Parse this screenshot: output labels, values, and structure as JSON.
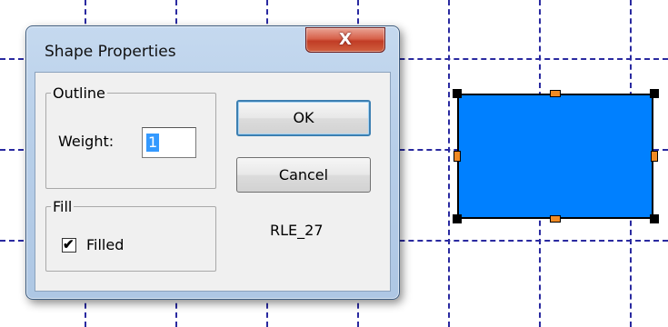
{
  "dialog": {
    "title": "Shape Properties",
    "close_glyph": "X",
    "outline": {
      "legend": "Outline",
      "weight_label": "Weight:",
      "weight_value": "1"
    },
    "fill": {
      "legend": "Fill",
      "filled_label": "Filled",
      "filled_checked": true,
      "check_glyph": "✔"
    },
    "ok_label": "OK",
    "cancel_label": "Cancel",
    "shape_id": "RLE_27"
  },
  "shape": {
    "type": "rectangle",
    "fill_color": "#0080ff",
    "selected": true
  },
  "colors": {
    "grid_line": "#2a2aa0",
    "handle_mid": "#f08a24",
    "selection_highlight": "#3399ff"
  }
}
